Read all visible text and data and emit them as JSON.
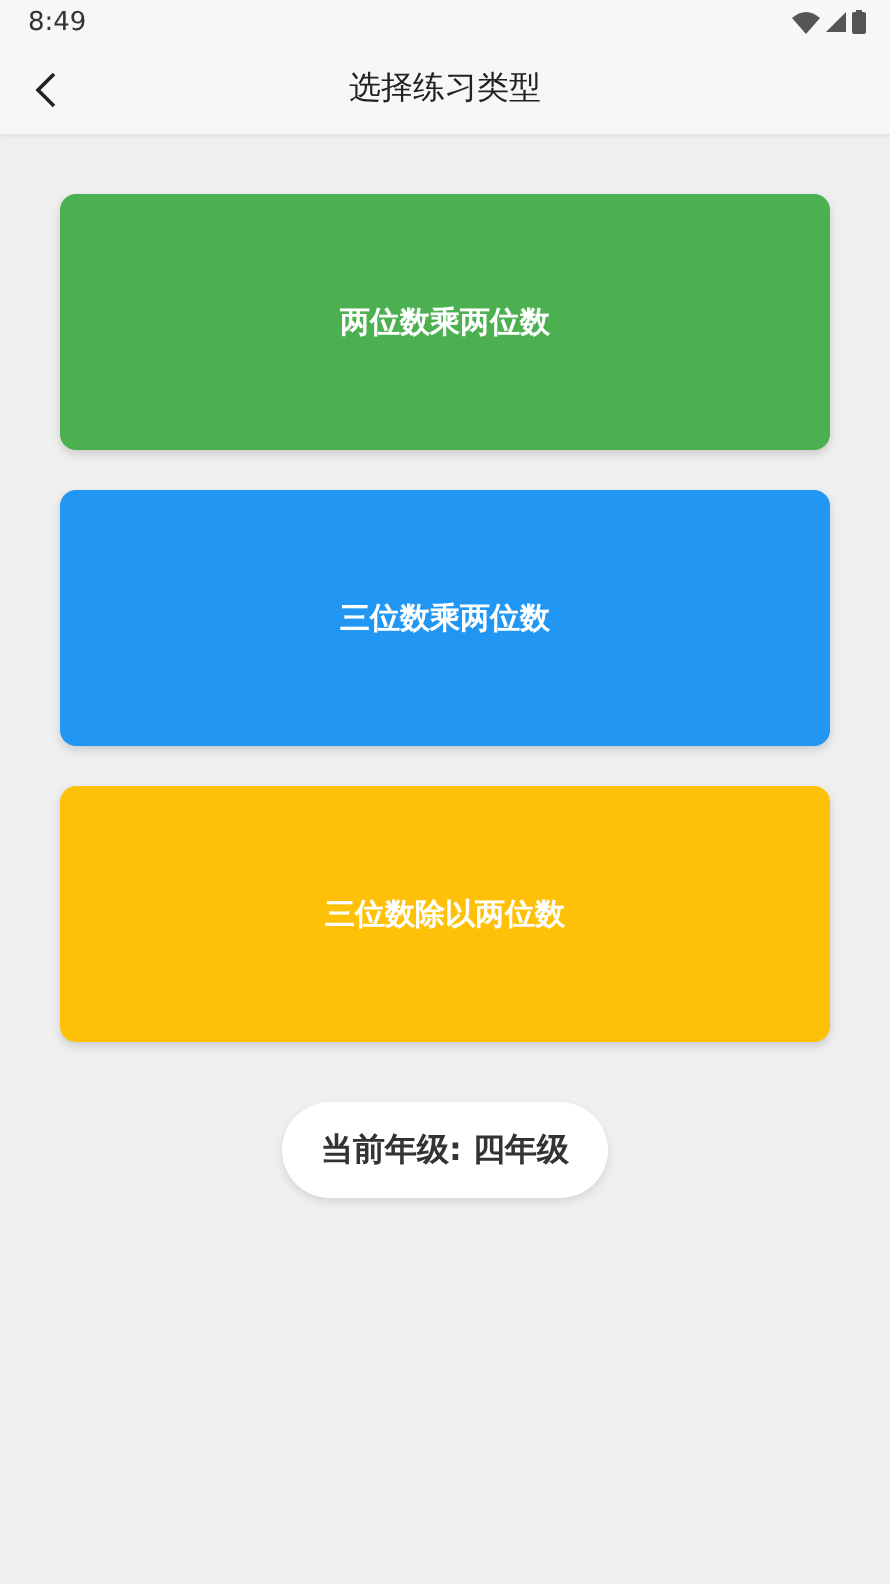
{
  "status_bar": {
    "time": "8:49"
  },
  "header": {
    "title": "选择练习类型"
  },
  "options": [
    {
      "label": "两位数乘两位数",
      "color": "#4caf50"
    },
    {
      "label": "三位数乘两位数",
      "color": "#2196f3"
    },
    {
      "label": "三位数除以两位数",
      "color": "#ffc107"
    }
  ],
  "grade_badge": {
    "text": "当前年级: 四年级"
  }
}
